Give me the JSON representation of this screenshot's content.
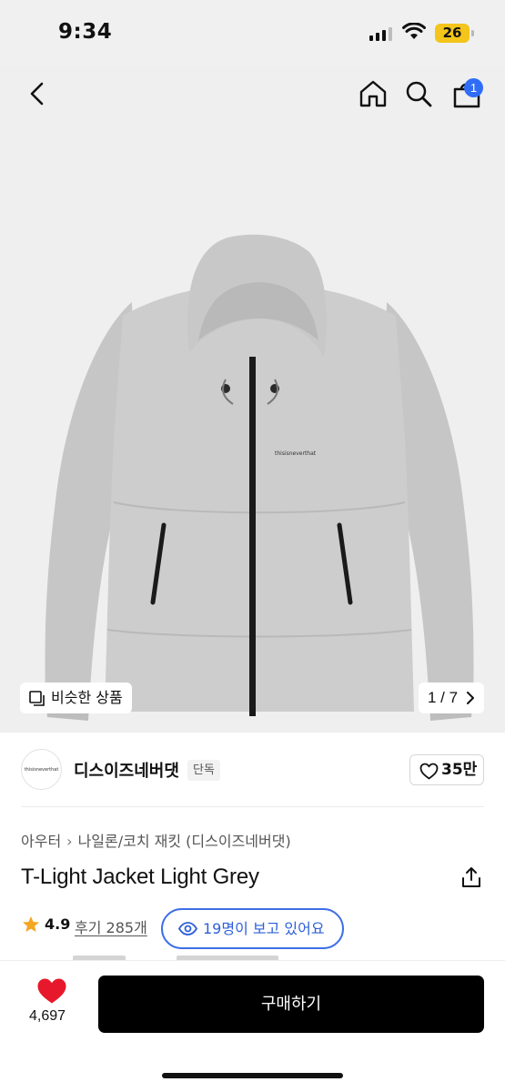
{
  "status_bar": {
    "time": "9:34",
    "battery": "26"
  },
  "nav": {
    "cart_count": "1"
  },
  "gallery": {
    "similar_label": "비슷한 상품",
    "pager": "1 / 7",
    "jacket_logo_text": "thisisneverthat"
  },
  "brand": {
    "name": "디스이즈네버댓",
    "tag": "단독",
    "logo_text": "thisisneverthat",
    "likes": "35만"
  },
  "breadcrumb": {
    "category": "아우터",
    "subcategory": "나일론/코치 재킷 (디스이즈네버댓)"
  },
  "product": {
    "title": "T-Light Jacket Light Grey"
  },
  "rating": {
    "value": "4.9",
    "reviews": "후기 285개",
    "viewers": "19명이 보고 있어요"
  },
  "bottom": {
    "wish_count": "4,697",
    "buy_label": "구매하기"
  },
  "colors": {
    "accent_blue": "#2f6df6",
    "heart_red": "#e8182c",
    "star_orange": "#f5a623"
  }
}
